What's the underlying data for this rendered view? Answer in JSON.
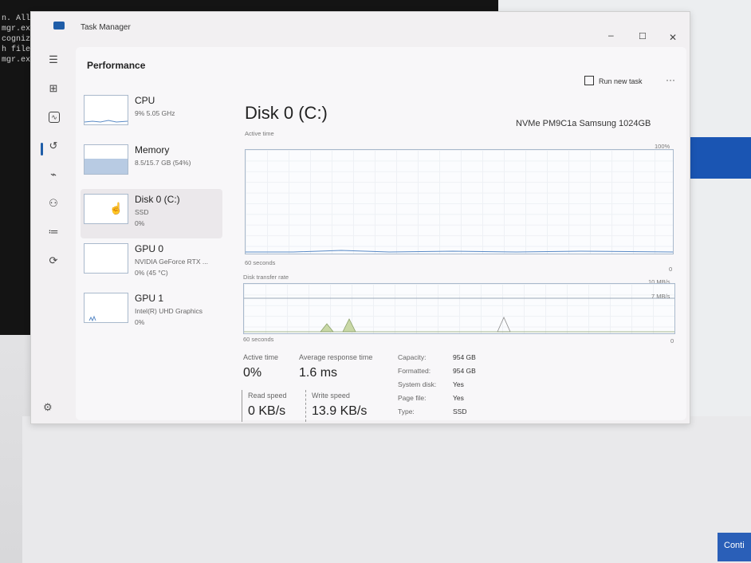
{
  "terminal": {
    "lines": [
      "n. All ri",
      "mgr.exe",
      "cognized",
      "h file.",
      "",
      "mgr.exe"
    ]
  },
  "window": {
    "title": "Task Manager",
    "minimize": "–",
    "maximize": "☐",
    "close": "✕"
  },
  "page": {
    "title": "Performance",
    "run_new_task": "Run new task",
    "more": "···"
  },
  "devices": [
    {
      "name": "CPU",
      "sub1": "9%  5.05 GHz",
      "sub2": ""
    },
    {
      "name": "Memory",
      "sub1": "8.5/15.7 GB (54%)",
      "sub2": ""
    },
    {
      "name": "Disk 0 (C:)",
      "sub1": "SSD",
      "sub2": "0%"
    },
    {
      "name": "GPU 0",
      "sub1": "NVIDIA GeForce RTX ...",
      "sub2": "0% (45 °C)"
    },
    {
      "name": "GPU 1",
      "sub1": "Intel(R) UHD Graphics",
      "sub2": "0%"
    }
  ],
  "memory_usage_fraction": 0.54,
  "disk": {
    "title": "Disk 0 (C:)",
    "model": "NVMe PM9C1a Samsung 1024GB",
    "graph1": {
      "label": "Active time",
      "max": "100%",
      "time": "60 seconds",
      "min": "0"
    },
    "graph2": {
      "label": "Disk transfer rate",
      "max": "10 MB/s",
      "mid": "7 MB/s",
      "time": "60 seconds",
      "min": "0"
    }
  },
  "stats": {
    "active_time_label": "Active time",
    "active_time_value": "0%",
    "avg_resp_label": "Average response time",
    "avg_resp_value": "1.6 ms",
    "read_label": "Read speed",
    "read_value": "0 KB/s",
    "write_label": "Write speed",
    "write_value": "13.9 KB/s"
  },
  "properties": [
    {
      "key": "Capacity:",
      "value": "954 GB"
    },
    {
      "key": "Formatted:",
      "value": "954 GB"
    },
    {
      "key": "System disk:",
      "value": "Yes"
    },
    {
      "key": "Page file:",
      "value": "Yes"
    },
    {
      "key": "Type:",
      "value": "SSD"
    }
  ],
  "background": {
    "continue_button": "Conti"
  },
  "colors": {
    "accent": "#1f5da8",
    "graph_border": "#a9b9cc",
    "transfer_fill": "#c9d8a6"
  }
}
